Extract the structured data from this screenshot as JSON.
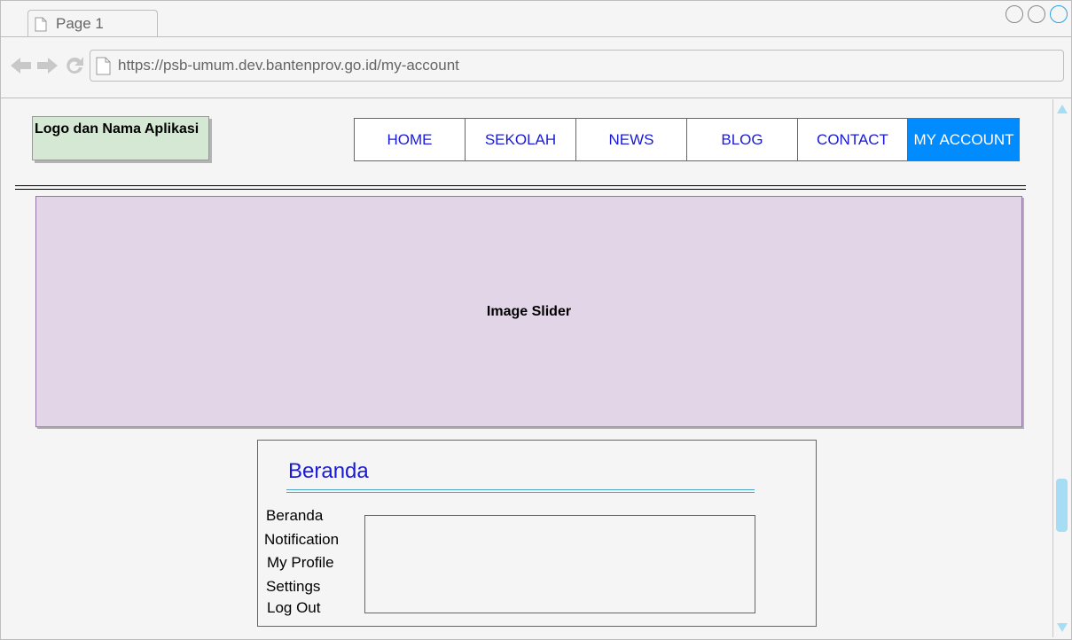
{
  "browser": {
    "tab_title": "Page 1",
    "url": "https://psb-umum.dev.bantenprov.go.id/my-account"
  },
  "header": {
    "logo_text": "Logo dan Nama Aplikasi",
    "menu": [
      {
        "label": "HOME",
        "active": false
      },
      {
        "label": "SEKOLAH",
        "active": false
      },
      {
        "label": "NEWS",
        "active": false
      },
      {
        "label": "BLOG",
        "active": false
      },
      {
        "label": "CONTACT",
        "active": false
      },
      {
        "label": "MY ACCOUNT",
        "active": true
      }
    ]
  },
  "slider": {
    "label": "Image Slider"
  },
  "account": {
    "title": "Beranda",
    "sidebar": [
      "Beranda",
      "Notification",
      "My Profile",
      "Settings",
      "Log Out"
    ]
  },
  "colors": {
    "active_menu_bg": "#008cff",
    "link_blue": "#1a1ad6",
    "logo_bg": "#d5e8d4",
    "slider_bg": "#e1d5e7"
  }
}
